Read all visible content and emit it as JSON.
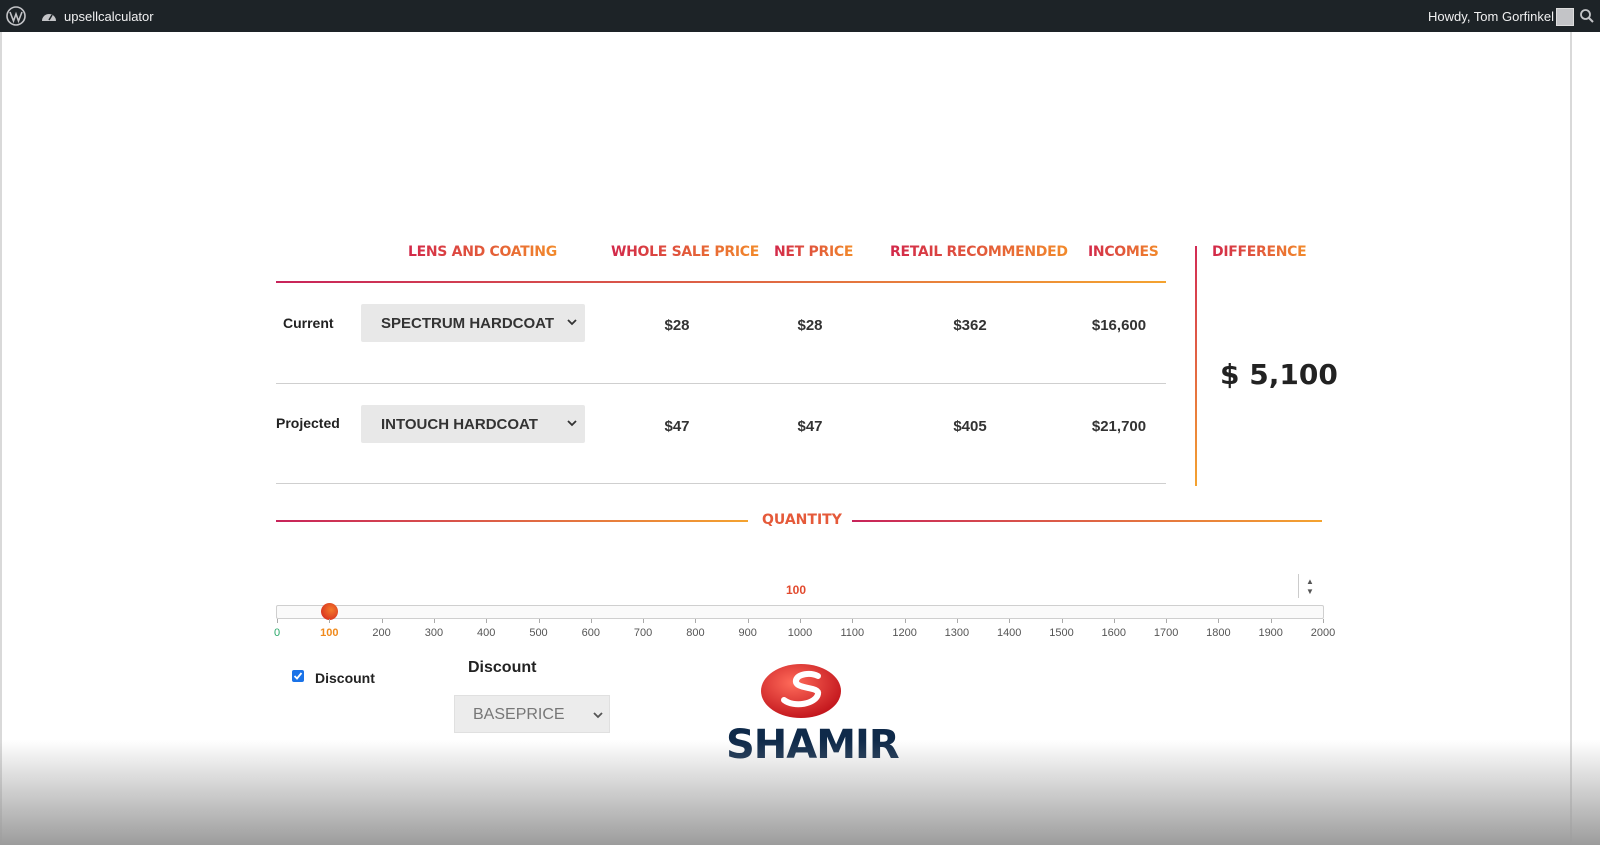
{
  "admin_bar": {
    "site_name": "upsellcalculator",
    "greeting": "Howdy, Tom Gorfinkel"
  },
  "table": {
    "headers": {
      "lens": "LENS AND COATING",
      "wholesale": "WHOLE SALE PRICE",
      "net": "NET PRICE",
      "retail": "RETAIL RECOMMENDED",
      "incomes": "INCOMES",
      "difference": "DIFFERENCE"
    },
    "rows": [
      {
        "label": "Current",
        "lens": "SPECTRUM HARDCOAT",
        "wholesale": "$28",
        "net": "$28",
        "retail": "$362",
        "incomes": "$16,600"
      },
      {
        "label": "Projected",
        "lens": "INTOUCH HARDCOAT",
        "wholesale": "$47",
        "net": "$47",
        "retail": "$405",
        "incomes": "$21,700"
      }
    ],
    "difference_value": "$ 5,100"
  },
  "quantity": {
    "title": "QUANTITY",
    "value": "100",
    "slider_value": 100,
    "slider_min": 0,
    "slider_max": 2000,
    "ticks": [
      "0",
      "100",
      "200",
      "300",
      "400",
      "500",
      "600",
      "700",
      "800",
      "900",
      "1000",
      "1100",
      "1200",
      "1300",
      "1400",
      "1500",
      "1600",
      "1700",
      "1800",
      "1900",
      "2000"
    ]
  },
  "discount": {
    "checkbox_label": "Discount",
    "checked": true,
    "title": "Discount",
    "selected": "BASEPRICE"
  },
  "logo": {
    "text": "SHAMIR"
  },
  "colors": {
    "accent_start": "#d2284a",
    "accent_end": "#f4a330",
    "adminbar_bg": "#1d2327"
  }
}
